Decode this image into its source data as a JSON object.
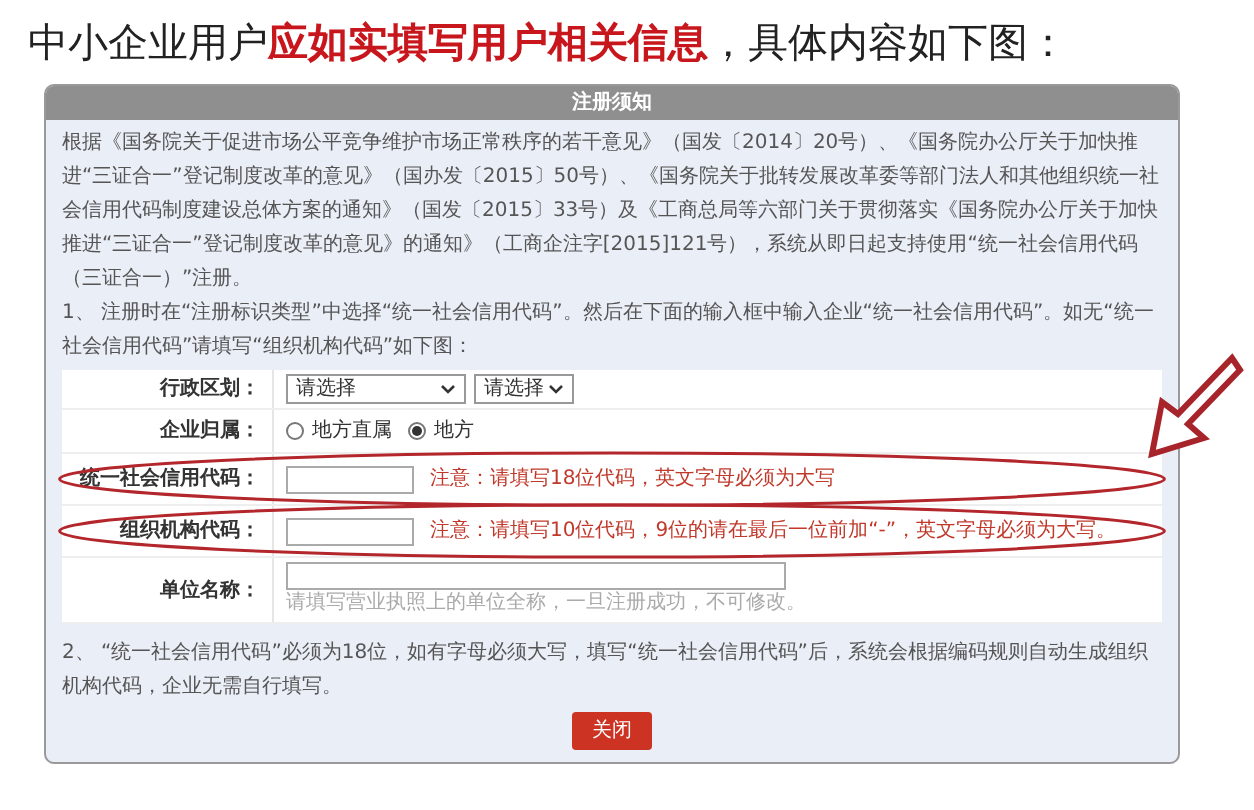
{
  "caption": [
    {
      "text": "中小企业用户",
      "highlight": false
    },
    {
      "text": "应如实填写用户相关信息",
      "highlight": true
    },
    {
      "text": "，具体内容如下图：",
      "highlight": false
    }
  ],
  "dialog": {
    "title": "注册须知",
    "paragraphs": [
      "根据《国务院关于促进市场公平竞争维护市场正常秩序的若干意见》（国发〔2014〕20号）、《国务院办公厅关于加快推进“三证合一”登记制度改革的意见》（国办发〔2015〕50号）、《国务院关于批转发展改革委等部门法人和其他组织统一社会信用代码制度建设总体方案的通知》（国发〔2015〕33号）及《工商总局等六部门关于贯彻落实《国务院办公厅关于加快推进“三证合一”登记制度改革的意见》的通知》（工商企注字[2015]121号），系统从即日起支持使用“统一社会信用代码（三证合一）”注册。",
      "1、 注册时在“注册标识类型”中选择“统一社会信用代码”。然后在下面的输入框中输入企业“统一社会信用代码”。如无“统一社会信用代码”请填写“组织机构代码”如下图："
    ],
    "form": [
      {
        "kind": "select",
        "label": "行政区划：",
        "selects": [
          "请选择",
          "请选择"
        ]
      },
      {
        "kind": "radio",
        "label": "企业归属：",
        "options": [
          {
            "label": "地方直属",
            "selected": false
          },
          {
            "label": "地方",
            "selected": true
          }
        ]
      },
      {
        "kind": "input",
        "label": "统一社会信用代码：",
        "note": "注意：请填写18位代码，英文字母必须为大写",
        "circled": true
      },
      {
        "kind": "input",
        "label": "组织机构代码：",
        "note": "注意：请填写10位代码，9位的请在最后一位前加“-”，英文字母必须为大写。",
        "circled": true
      },
      {
        "kind": "wide",
        "label": "单位名称：",
        "hint": "请填写营业执照上的单位全称，一旦注册成功，不可修改。",
        "circled": false
      }
    ],
    "footer": "2、 “统一社会信用代码”必须为18位，如有字母必须大写，填写“统一社会信用代码”后，系统会根据编码规则自动生成组织机构代码，企业无需自行填写。",
    "close_button": "关闭"
  }
}
